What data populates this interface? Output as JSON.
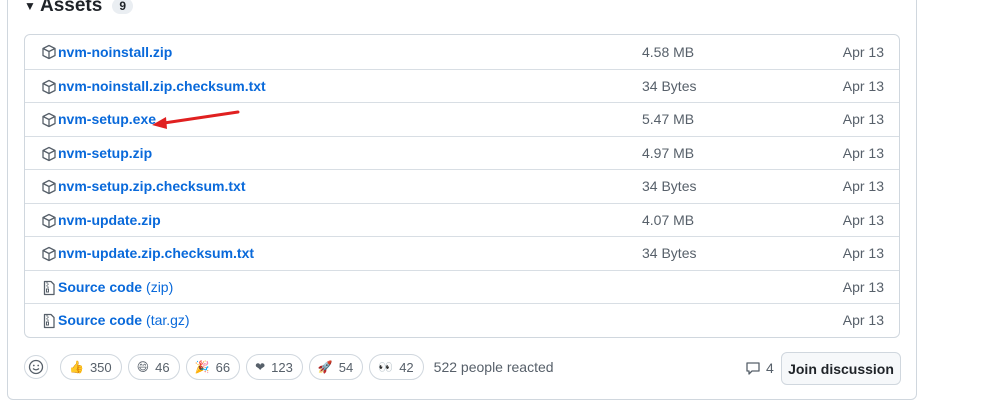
{
  "assets": {
    "title": "Assets",
    "count": "9",
    "items": [
      {
        "icon": "package-icon",
        "name": "nvm-noinstall.zip",
        "suffix": "",
        "size": "4.58 MB",
        "date": "Apr 13"
      },
      {
        "icon": "package-icon",
        "name": "nvm-noinstall.zip.checksum.txt",
        "suffix": "",
        "size": "34 Bytes",
        "date": "Apr 13"
      },
      {
        "icon": "package-icon",
        "name": "nvm-setup.exe",
        "suffix": "",
        "size": "5.47 MB",
        "date": "Apr 13"
      },
      {
        "icon": "package-icon",
        "name": "nvm-setup.zip",
        "suffix": "",
        "size": "4.97 MB",
        "date": "Apr 13"
      },
      {
        "icon": "package-icon",
        "name": "nvm-setup.zip.checksum.txt",
        "suffix": "",
        "size": "34 Bytes",
        "date": "Apr 13"
      },
      {
        "icon": "package-icon",
        "name": "nvm-update.zip",
        "suffix": "",
        "size": "4.07 MB",
        "date": "Apr 13"
      },
      {
        "icon": "package-icon",
        "name": "nvm-update.zip.checksum.txt",
        "suffix": "",
        "size": "34 Bytes",
        "date": "Apr 13"
      },
      {
        "icon": "file-zip-icon",
        "name": "Source code",
        "suffix": "(zip)",
        "size": "",
        "date": "Apr 13"
      },
      {
        "icon": "file-zip-icon",
        "name": "Source code",
        "suffix": "(tar.gz)",
        "size": "",
        "date": "Apr 13"
      }
    ]
  },
  "reactions": {
    "items": [
      {
        "icon": "thumbs-up-icon",
        "emoji": "👍",
        "count": "350"
      },
      {
        "icon": "laugh-icon",
        "emoji": "😄",
        "count": "46"
      },
      {
        "icon": "hooray-icon",
        "emoji": "🎉",
        "count": "66"
      },
      {
        "icon": "heart-icon",
        "emoji": "❤",
        "count": "123"
      },
      {
        "icon": "rocket-icon",
        "emoji": "🚀",
        "count": "54"
      },
      {
        "icon": "eyes-icon",
        "emoji": "👀",
        "count": "42"
      }
    ],
    "summary": "522 people reacted"
  },
  "discussion": {
    "comment_count": "4",
    "join_label": "Join discussion"
  },
  "colors": {
    "link": "#0969da",
    "annotation_arrow": "#e02020",
    "border": "#d0d7de",
    "muted_text": "#57606a"
  }
}
